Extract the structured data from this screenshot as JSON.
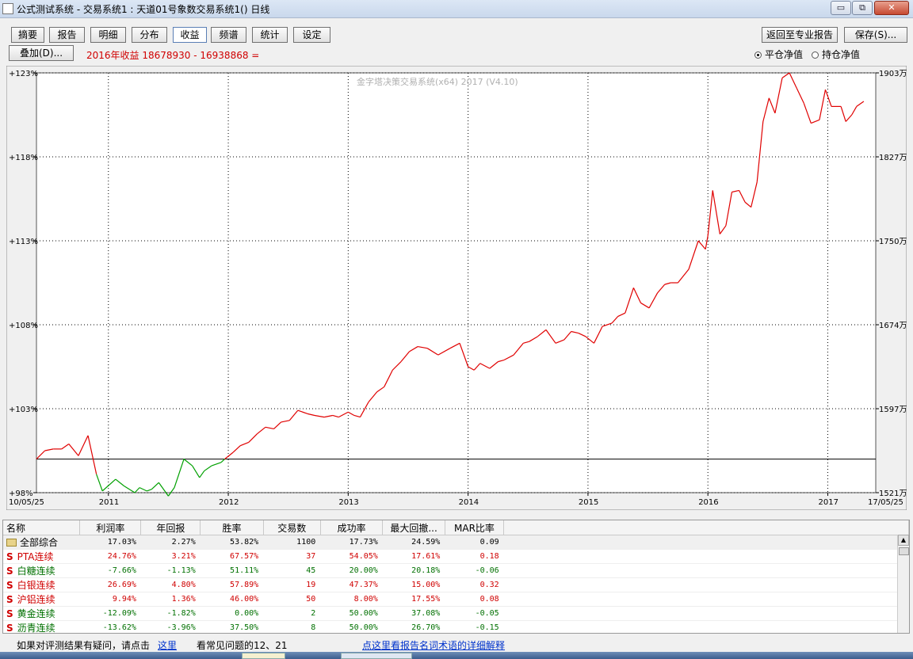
{
  "window": {
    "title": "公式测试系统 - 交易系统1 : 天道01号象数交易系统1() 日线",
    "btn_minimize": "▭",
    "btn_restore": "⧉",
    "btn_close": "✕"
  },
  "toolbar": {
    "tabs": [
      "摘要",
      "报告",
      "明细",
      "分布",
      "收益",
      "频谱",
      "统计",
      "设定"
    ],
    "active_tab": "收益",
    "back_button": "返回至专业报告",
    "save_button": "保存(S)...",
    "overlay_button": "叠加(D)...",
    "summary_text": "2016年收益 18678930 - 16938868 ="
  },
  "options": {
    "flat_equity": "平仓净值",
    "hold_equity": "持仓净值",
    "selected": "flat_equity"
  },
  "chart_data": {
    "type": "line",
    "watermark": "金字塔决策交易系统(x64) 2017 (V4.10)",
    "y_left_ticks": [
      "+123%",
      "+118%",
      "+113%",
      "+108%",
      "+103%",
      "+98%"
    ],
    "y_right_ticks": [
      "1903万",
      "1827万",
      "1750万",
      "1674万",
      "1597万",
      "1521万"
    ],
    "ylim": [
      98,
      123
    ],
    "x_start_label": "10/05/25",
    "x_end_label": "17/05/25",
    "x_year_labels": [
      "2011",
      "2012",
      "2013",
      "2014",
      "2015",
      "2016",
      "2017"
    ],
    "xlim": [
      2010.4,
      2017.4
    ],
    "baseline": 100,
    "colors": {
      "above": "#e00000",
      "below": "#00a000",
      "baseline": "#000000"
    },
    "x": [
      2010.4,
      2010.47,
      2010.54,
      2010.61,
      2010.67,
      2010.75,
      2010.83,
      2010.9,
      2010.95,
      2011.06,
      2011.13,
      2011.22,
      2011.26,
      2011.32,
      2011.36,
      2011.42,
      2011.5,
      2011.55,
      2011.63,
      2011.7,
      2011.76,
      2011.8,
      2011.86,
      2011.94,
      2011.97,
      2012.04,
      2012.1,
      2012.17,
      2012.24,
      2012.31,
      2012.38,
      2012.44,
      2012.51,
      2012.58,
      2012.66,
      2012.72,
      2012.8,
      2012.87,
      2012.92,
      2013.0,
      2013.05,
      2013.1,
      2013.17,
      2013.24,
      2013.3,
      2013.37,
      2013.44,
      2013.51,
      2013.58,
      2013.66,
      2013.75,
      2013.85,
      2013.93,
      2014.0,
      2014.05,
      2014.1,
      2014.18,
      2014.25,
      2014.3,
      2014.38,
      2014.46,
      2014.51,
      2014.58,
      2014.65,
      2014.73,
      2014.8,
      2014.86,
      2014.92,
      2014.98,
      2015.05,
      2015.12,
      2015.2,
      2015.25,
      2015.31,
      2015.38,
      2015.44,
      2015.51,
      2015.58,
      2015.64,
      2015.69,
      2015.75,
      2015.84,
      2015.92,
      2015.98,
      2016.0,
      2016.04,
      2016.1,
      2016.15,
      2016.2,
      2016.26,
      2016.31,
      2016.36,
      2016.41,
      2016.46,
      2016.51,
      2016.56,
      2016.62,
      2016.68,
      2016.74,
      2016.8,
      2016.86,
      2016.93,
      2016.98,
      2017.03,
      2017.11,
      2017.15,
      2017.2,
      2017.24,
      2017.3
    ],
    "y": [
      100.0,
      100.5,
      100.6,
      100.6,
      100.9,
      100.2,
      101.4,
      99.1,
      98.1,
      98.8,
      98.4,
      98.0,
      98.3,
      98.1,
      98.2,
      98.6,
      97.8,
      98.3,
      100.0,
      99.6,
      98.9,
      99.3,
      99.6,
      99.8,
      100.0,
      100.4,
      100.8,
      101.0,
      101.5,
      101.9,
      101.8,
      102.2,
      102.3,
      102.9,
      102.7,
      102.6,
      102.5,
      102.6,
      102.5,
      102.8,
      102.6,
      102.5,
      103.4,
      104.0,
      104.3,
      105.3,
      105.8,
      106.4,
      106.7,
      106.6,
      106.2,
      106.6,
      106.9,
      105.5,
      105.3,
      105.7,
      105.4,
      105.8,
      105.9,
      106.2,
      106.9,
      107.0,
      107.3,
      107.7,
      106.9,
      107.1,
      107.6,
      107.5,
      107.3,
      106.9,
      107.9,
      108.1,
      108.5,
      108.7,
      110.2,
      109.3,
      109.0,
      109.9,
      110.4,
      110.5,
      110.5,
      111.3,
      113.0,
      112.5,
      113.3,
      116.0,
      113.4,
      113.9,
      115.9,
      116.0,
      115.3,
      115.0,
      116.5,
      120.1,
      121.5,
      120.6,
      122.7,
      123.0,
      122.1,
      121.2,
      120.0,
      120.2,
      122.0,
      121.0,
      121.0,
      120.1,
      120.5,
      121.0,
      121.3
    ]
  },
  "table": {
    "headers": [
      "名称",
      "利润率",
      "年回报",
      "胜率",
      "交易数",
      "成功率",
      "最大回撤...",
      "MAR比率"
    ],
    "rows": [
      {
        "icon": "folder",
        "color": "black",
        "cells": [
          "全部综合",
          "17.03%",
          "2.27%",
          "53.82%",
          "1100",
          "17.73%",
          "24.59%",
          "0.09"
        ]
      },
      {
        "icon": "S",
        "color": "red",
        "cells": [
          "PTA连续",
          "24.76%",
          "3.21%",
          "67.57%",
          "37",
          "54.05%",
          "17.61%",
          "0.18"
        ]
      },
      {
        "icon": "S",
        "color": "green",
        "cells": [
          "白糖连续",
          "-7.66%",
          "-1.13%",
          "51.11%",
          "45",
          "20.00%",
          "20.18%",
          "-0.06"
        ]
      },
      {
        "icon": "S",
        "color": "red",
        "cells": [
          "白银连续",
          "26.69%",
          "4.80%",
          "57.89%",
          "19",
          "47.37%",
          "15.00%",
          "0.32"
        ]
      },
      {
        "icon": "S",
        "color": "red",
        "cells": [
          "沪铝连续",
          "9.94%",
          "1.36%",
          "46.00%",
          "50",
          "8.00%",
          "17.55%",
          "0.08"
        ]
      },
      {
        "icon": "S",
        "color": "green",
        "cells": [
          "黄金连续",
          "-12.09%",
          "-1.82%",
          "0.00%",
          "2",
          "50.00%",
          "37.08%",
          "-0.05"
        ]
      },
      {
        "icon": "S",
        "color": "green",
        "cells": [
          "沥青连续",
          "-13.62%",
          "-3.96%",
          "37.50%",
          "8",
          "50.00%",
          "26.70%",
          "-0.15"
        ]
      }
    ]
  },
  "footer": {
    "question_text": "如果对评测结果有疑问，请点击",
    "here_link": "这里",
    "faq_text": "看常见问题的12、21",
    "glossary_link": "点这里看报告名词术语的详细解释"
  }
}
